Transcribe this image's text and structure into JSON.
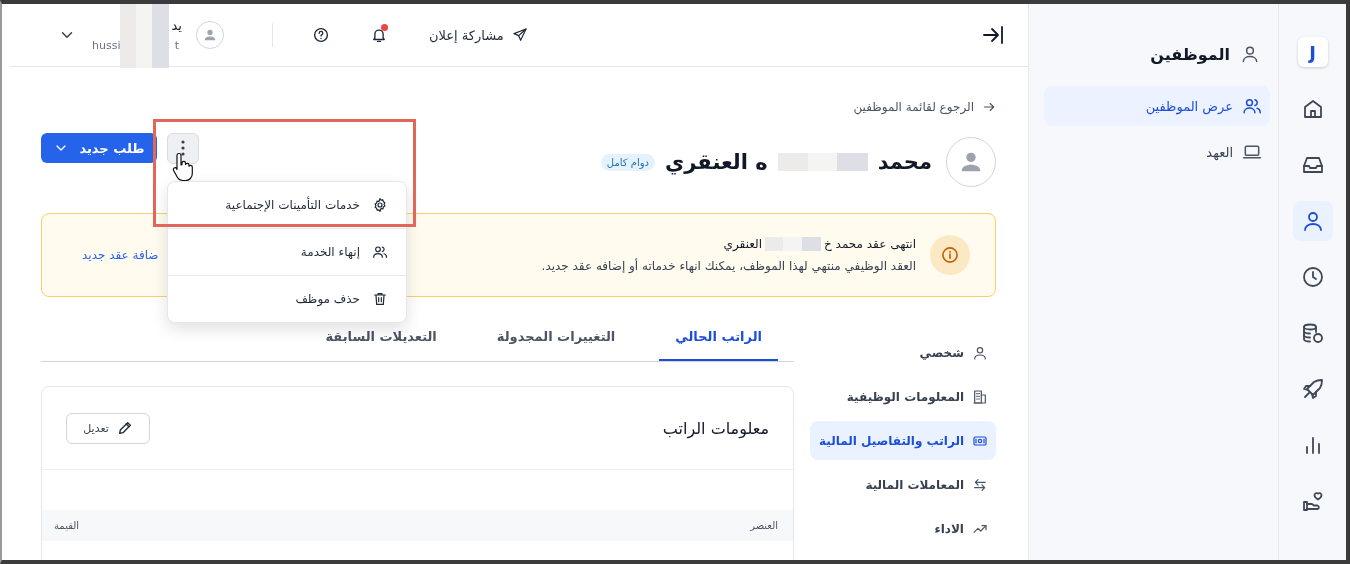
{
  "rail": {
    "logo": "J",
    "items": [
      {
        "kind": "home",
        "selected": false
      },
      {
        "kind": "inbox",
        "selected": false
      },
      {
        "kind": "user",
        "selected": true
      },
      {
        "kind": "clock",
        "selected": false
      },
      {
        "kind": "coins",
        "selected": false
      },
      {
        "kind": "rocket",
        "selected": false
      },
      {
        "kind": "chart",
        "selected": false
      },
      {
        "kind": "handheart",
        "selected": false
      }
    ]
  },
  "subnav": {
    "title": "الموظفين",
    "items": [
      {
        "label": "عرض الموظفين",
        "kind": "users",
        "selected": true
      },
      {
        "label": "العهد",
        "kind": "laptop",
        "selected": false
      }
    ]
  },
  "top_bar": {
    "share": "مشاركة إعلان",
    "notifications": {
      "unread": true
    },
    "user": {
      "name_end": "يد",
      "email_start": "hussi",
      "email_end": "t"
    }
  },
  "back_link": "الرجوع لقائمة الموظفين",
  "employee": {
    "name_start": "محمد",
    "name_end": "ه العنقري",
    "badge": "دوام كامل"
  },
  "new_request_button": "طلب جديد",
  "actions_menu": {
    "open": true,
    "highlighted": true,
    "items": [
      {
        "label": "خدمات التأمينات الإجتماعية",
        "kind": "gear"
      },
      {
        "label": "إنهاء الخدمة",
        "kind": "users"
      },
      {
        "label": "حذف موظف",
        "kind": "trash"
      }
    ]
  },
  "alert": {
    "title_start": "انتهى عقد محمد خ",
    "title_end": "العنقري",
    "message": "العقد الوظيفي منتهي لهذا الموظف، يمكنك انهاء خدماته أو إضافه عقد جديد.",
    "link": "ضافة عقد جديد"
  },
  "sections": [
    {
      "label": "شخصي",
      "kind": "user",
      "selected": false
    },
    {
      "label": "المعلومات الوظيفية",
      "kind": "building",
      "selected": false
    },
    {
      "label": "الراتب والتفاصيل المالية",
      "kind": "money",
      "selected": true
    },
    {
      "label": "المعاملات المالية",
      "kind": "swap",
      "selected": false
    },
    {
      "label": "الاداء",
      "kind": "trend",
      "selected": false
    }
  ],
  "tabs": [
    {
      "label": "الراتب الحالي",
      "selected": true
    },
    {
      "label": "التغييرات المجدولة",
      "selected": false
    },
    {
      "label": "التعديلات السابقة",
      "selected": false
    }
  ],
  "salary_card": {
    "title": "معلومات الراتب",
    "edit_button": "تعديل",
    "columns": [
      "العنصر",
      "القيمة"
    ]
  }
}
